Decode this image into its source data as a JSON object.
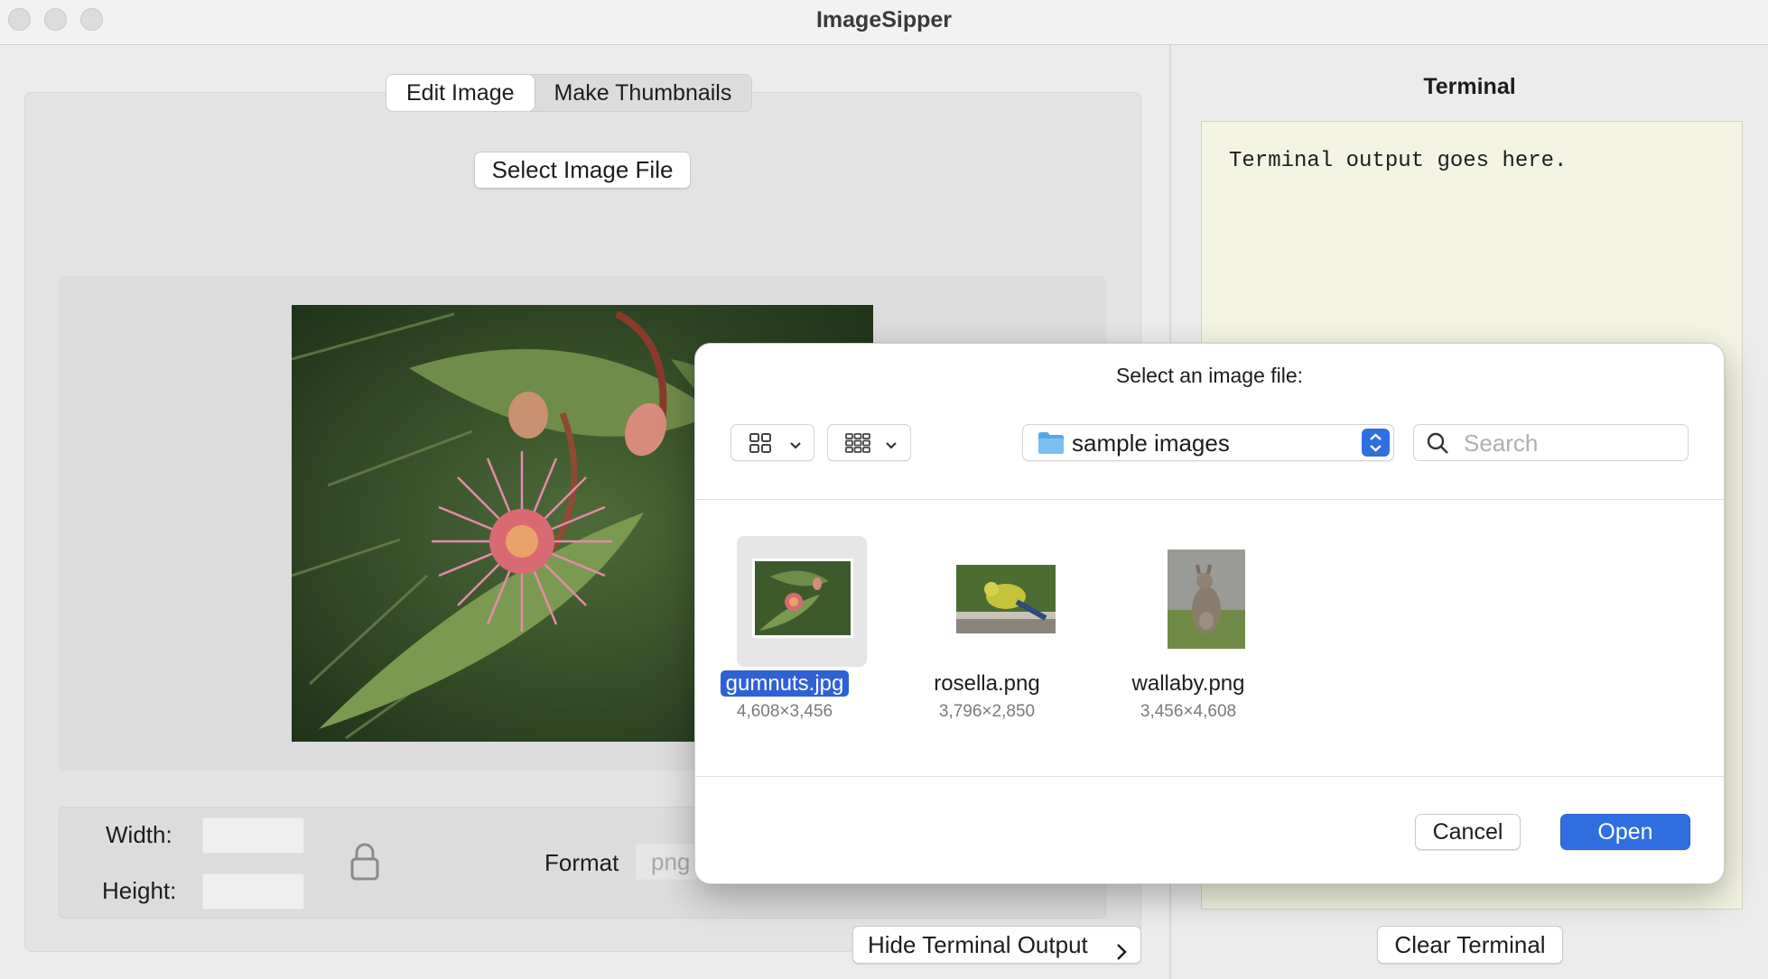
{
  "window": {
    "title": "ImageSipper"
  },
  "editor": {
    "tabs": [
      {
        "label": "Edit Image",
        "active": true
      },
      {
        "label": "Make Thumbnails",
        "active": false
      }
    ],
    "select_button": "Select Image File",
    "width_label": "Width:",
    "height_label": "Height:",
    "width_value": "",
    "height_value": "",
    "format_label": "Format",
    "format_value": "png",
    "hide_terminal_button": "Hide Terminal Output"
  },
  "terminal": {
    "title": "Terminal",
    "output": "Terminal output goes here.",
    "clear_button": "Clear Terminal"
  },
  "dialog": {
    "title": "Select an image file:",
    "location": "sample images",
    "search_placeholder": "Search",
    "files": [
      {
        "name": "gumnuts.jpg",
        "dimensions": "4,608×3,456",
        "selected": true
      },
      {
        "name": "rosella.png",
        "dimensions": "3,796×2,850",
        "selected": false
      },
      {
        "name": "wallaby.png",
        "dimensions": "3,456×4,608",
        "selected": false
      }
    ],
    "cancel_button": "Cancel",
    "open_button": "Open"
  },
  "colors": {
    "accent": "#2f6fdf",
    "terminal_background": "#f4f4e2",
    "window_background": "#ececec"
  },
  "icons": [
    "grid-view-icon",
    "column-view-icon",
    "chevron-down-icon",
    "folder-icon",
    "stepper-icon",
    "search-icon",
    "lock-icon",
    "chevron-right-icon"
  ]
}
